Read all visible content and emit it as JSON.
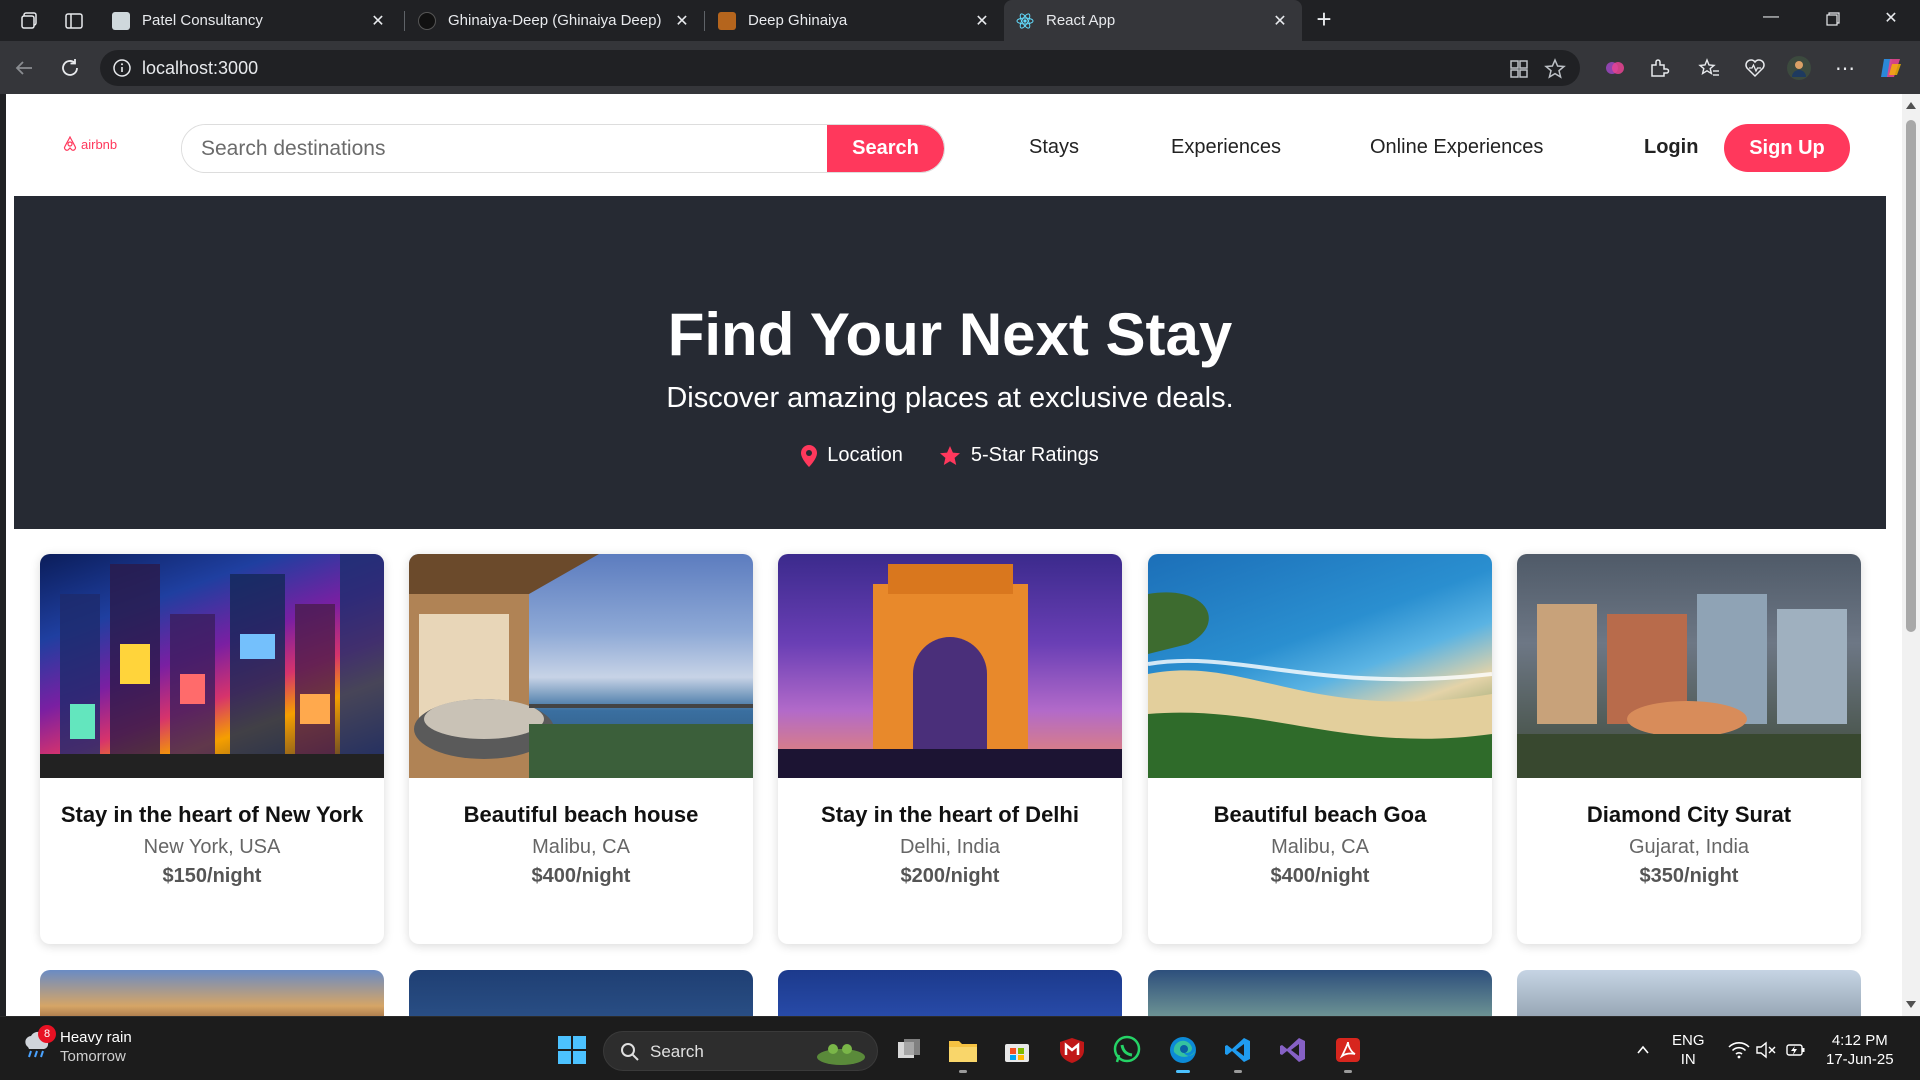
{
  "browser": {
    "tabs": [
      {
        "title": "Patel Consultancy",
        "active": false
      },
      {
        "title": "Ghinaiya-Deep (Ghinaiya Deep)",
        "active": false
      },
      {
        "title": "Deep Ghinaiya",
        "active": false
      },
      {
        "title": "React App",
        "active": true
      }
    ],
    "url": "localhost:3000"
  },
  "site": {
    "logo_text": "airbnb",
    "search": {
      "placeholder": "Search destinations",
      "button": "Search"
    },
    "nav": [
      "Stays",
      "Experiences",
      "Online Experiences"
    ],
    "login": "Login",
    "signup": "Sign Up",
    "accent_color": "#ff385c"
  },
  "hero": {
    "title": "Find Your Next Stay",
    "subtitle": "Discover amazing places at exclusive deals.",
    "features": [
      {
        "icon": "location-pin-icon",
        "label": "Location"
      },
      {
        "icon": "star-icon",
        "label": "5-Star Ratings"
      }
    ]
  },
  "listings": [
    {
      "title": "Stay in the heart of New York",
      "location": "New York, USA",
      "price": "$150/night",
      "image": "times-square-night"
    },
    {
      "title": "Beautiful beach house",
      "location": "Malibu, CA",
      "price": "$400/night",
      "image": "ocean-view-balcony"
    },
    {
      "title": "Stay in the heart of Delhi",
      "location": "Delhi, India",
      "price": "$200/night",
      "image": "india-gate-dusk"
    },
    {
      "title": "Beautiful beach Goa",
      "location": "Malibu, CA",
      "price": "$400/night",
      "image": "goa-beach-coast"
    },
    {
      "title": "Diamond City Surat",
      "location": "Gujarat, India",
      "price": "$350/night",
      "image": "surat-diamond-bourse"
    }
  ],
  "taskbar": {
    "weather": {
      "badge": "8",
      "line1": "Heavy rain",
      "line2": "Tomorrow"
    },
    "search_label": "Search",
    "lang": {
      "line1": "ENG",
      "line2": "IN"
    },
    "clock": {
      "time": "4:12 PM",
      "date": "17-Jun-25"
    }
  }
}
